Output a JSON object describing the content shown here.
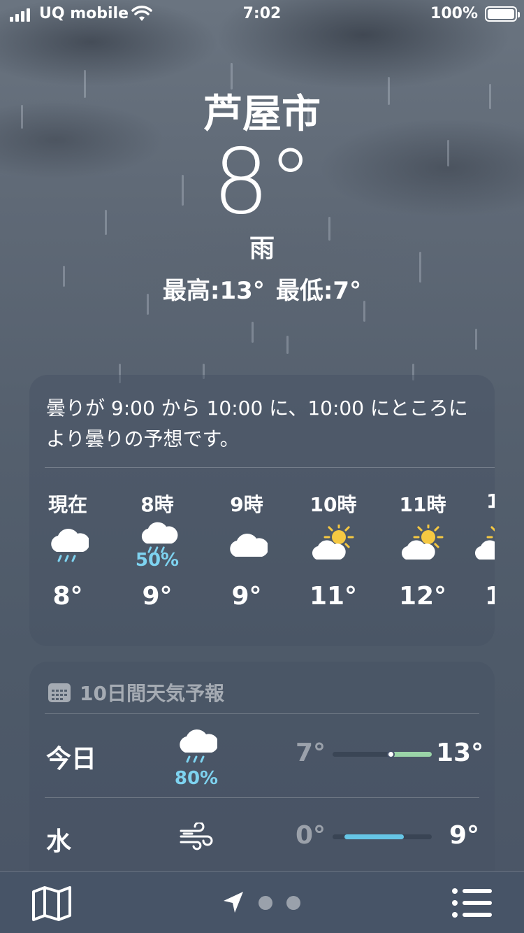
{
  "status_bar": {
    "carrier": "UQ mobile",
    "time": "7:02",
    "battery": "100%"
  },
  "location": {
    "city": "芦屋市",
    "temperature": "8°",
    "condition": "雨",
    "high": "最高:13°",
    "low": "最低:7°"
  },
  "hourly": {
    "summary": "曇りが 9:00 から 10:00 に、10:00 にところにより曇りの予想です。",
    "hours": [
      {
        "label": "現在",
        "icon": "cloud-rain-icon",
        "precip": "",
        "temp": "8°"
      },
      {
        "label": "8時",
        "icon": "cloud-rain-icon",
        "precip": "50%",
        "temp": "9°"
      },
      {
        "label": "9時",
        "icon": "cloud-icon",
        "precip": "",
        "temp": "9°"
      },
      {
        "label": "10時",
        "icon": "sun-behind-cloud-icon",
        "precip": "",
        "temp": "11°"
      },
      {
        "label": "11時",
        "icon": "sun-behind-cloud-icon",
        "precip": "",
        "temp": "12°"
      },
      {
        "label": "1",
        "icon": "sun-behind-cloud-icon",
        "precip": "",
        "temp": "1"
      }
    ]
  },
  "forecast": {
    "title": "10日間天気予報",
    "days": [
      {
        "name": "今日",
        "icon": "cloud-rain-icon",
        "precip": "80%",
        "low": "7°",
        "high": "13°",
        "range_start": 0.58,
        "range_end": 1.0,
        "color": "#9bd4a8"
      },
      {
        "name": "水",
        "icon": "wind-icon",
        "precip": "",
        "low": "0°",
        "high": "9°",
        "range_start": 0.12,
        "range_end": 0.72,
        "color": "#66c6e6"
      }
    ]
  },
  "colors": {
    "precip": "#7ed3f0",
    "sun": "#f5c842"
  },
  "tabbar": {
    "map_icon": "map-icon",
    "location_icon": "location-arrow-icon",
    "list_icon": "list-icon"
  }
}
